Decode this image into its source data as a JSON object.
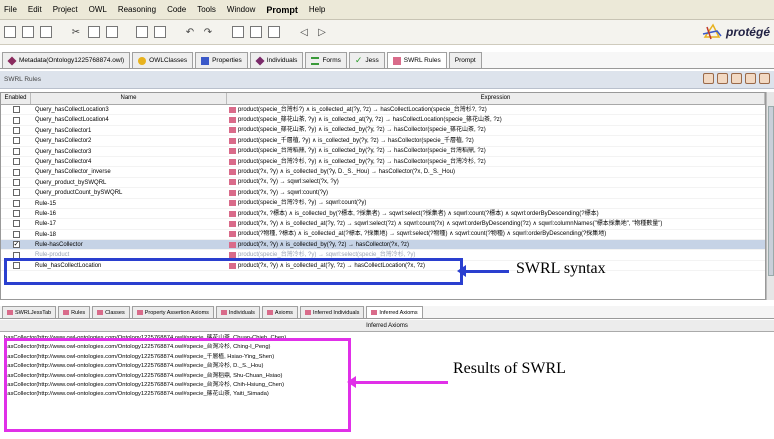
{
  "menu": [
    "File",
    "Edit",
    "Project",
    "OWL",
    "Reasoning",
    "Code",
    "Tools",
    "Window",
    "Prompt",
    "Help"
  ],
  "logo": {
    "text": "protégé"
  },
  "tabs": [
    {
      "label": "Metadata(Ontology1225768874.owl)",
      "icon": "diamond-icon",
      "color": "#8a2b5e"
    },
    {
      "label": "OWLClasses",
      "icon": "circle-icon",
      "color": "#e8b21e"
    },
    {
      "label": "Properties",
      "icon": "square-icon",
      "color": "#3b59c9"
    },
    {
      "label": "Individuals",
      "icon": "diamond-icon",
      "color": "#7a2a6a"
    },
    {
      "label": "Forms",
      "icon": "lines-icon",
      "color": "#3a9a3a"
    },
    {
      "label": "Jess",
      "icon": "check-icon",
      "color": "#2a9a2a"
    },
    {
      "label": "SWRL Rules",
      "icon": "rule-arrow-icon",
      "color": "#d96b8a"
    },
    {
      "label": "Prompt",
      "icon": "",
      "color": ""
    }
  ],
  "active_tab": 6,
  "panel_title": "SWRL Rules",
  "grid": {
    "headers": [
      "Enabled",
      "Name",
      "Expression"
    ],
    "rows": [
      {
        "name": "Query_hasCollectLocation3",
        "expr": "product(specie_台灣杉?) ∧ is_collected_at(?y, ?z) → hasCollectLocation(specie_台灣杉?, ?z)",
        "checked": false
      },
      {
        "name": "Query_hasCollectLocation4",
        "expr": "product(specie_篠花山茶, ?y) ∧ is_collected_at(?y, ?z) → hasCollectLocation(specie_篠花山茶, ?z)",
        "checked": false
      },
      {
        "name": "Query_hasCollector1",
        "expr": "product(specie_篠花山茶, ?y) ∧ is_collected_by(?y, ?z) → hasCollector(specie_篠花山茶, ?z)",
        "checked": false
      },
      {
        "name": "Query_hasCollector2",
        "expr": "product(specie_千層植, ?y) ∧ is_collected_by(?y, ?z) → hasCollector(specie_千層植, ?z)",
        "checked": false
      },
      {
        "name": "Query_hasCollector3",
        "expr": "product(specie_台灣稻鼎, ?y) ∧ is_collected_by(?y, ?z) → hasCollector(specie_台灣稻鼎, ?z)",
        "checked": false
      },
      {
        "name": "Query_hasCollector4",
        "expr": "product(specie_台灣冷杉, ?y) ∧ is_collected_by(?y, ?z) → hasCollector(specie_台灣冷杉, ?z)",
        "checked": false
      },
      {
        "name": "Query_hasCollector_inverse",
        "expr": "product(?x, ?y) ∧ is_collected_by(?y, D._S._Hou) → hasCollector(?x, D._S._Hou)",
        "checked": false
      },
      {
        "name": "Query_product_bySWQRL",
        "expr": "product(?x, ?y) → sqwrl:select(?x, ?y)",
        "checked": false
      },
      {
        "name": "Query_productCount_bySWQRL",
        "expr": "product(?x, ?y) → sqwrl:count(?y)",
        "checked": false
      },
      {
        "name": "Rule-15",
        "expr": "product(specie_台灣冷杉, ?y) → sqwrl:count(?y)",
        "checked": false
      },
      {
        "name": "Rule-16",
        "expr": "product(?x, ?標本) ∧ is_collected_by(?標本, ?採集者) → sqwrl:select(?採集者) ∧ sqwrl:count(?標本) ∧ sqwrl:orderByDescending(?標本)",
        "checked": false
      },
      {
        "name": "Rule-17",
        "expr": "product(?x, ?y) ∧ is_collected_at(?y, ?z) → sqwrl:select(?z) ∧ sqwrl:count(?x) ∧ sqwrl:orderByDescending(?z) ∧ sqwrl:columnNames(\"標本採集地\", \"物種數量\")",
        "checked": false
      },
      {
        "name": "Rule-18",
        "expr": "product(?物種, ?標本) ∧ is_collected_at(?標本, ?採集地) → sqwrl:select(?物種) ∧ sqwrl:count(?物種) ∧ sqwrl:orderByDescending(?採集地)",
        "checked": false
      },
      {
        "name": "Rule-hasCollector",
        "expr": "product(?x, ?y) ∧ is_collected_by(?y, ?z) → hasCollector(?x, ?z)",
        "checked": true
      },
      {
        "name": "Rule-product",
        "expr": "product(specie_台灣冷杉, ?y) → sqwrl:select(specie_台灣冷杉, ?y)",
        "checked": false
      },
      {
        "name": "Rule_hasCollectLocation",
        "expr": "product(?x, ?y) ∧ is_collected_at(?y, ?z) → hasCollectLocation(?x, ?z)",
        "checked": false
      }
    ],
    "selected_row": 13
  },
  "annotation_swrl": "SWRL syntax",
  "bottom_tabs": [
    "SWRLJessTab",
    "Rules",
    "Classes",
    "Property Assertion Axioms",
    "Individuals",
    "Axioms",
    "Inferred Individuals",
    "Inferred Axioms"
  ],
  "bottom_active_tab": 7,
  "inferred_header": "Inferred Axioms",
  "inferred_axioms": [
    "hasCollector(http://www.owl-ontologies.com/Ontology1225768874.owl#specie_篠花山茶, Chuan-Chieh_Chen)",
    "hasCollector(http://www.owl-ontologies.com/Ontology1225768874.owl#specie_台灣冷杉, Ching-I_Peng)",
    "hasCollector(http://www.owl-ontologies.com/Ontology1225768874.owl#specie_千層植, Hsiao-Ying_Shen)",
    "hasCollector(http://www.owl-ontologies.com/Ontology1225768874.owl#specie_台灣冷杉, D._S._Hou)",
    "hasCollector(http://www.owl-ontologies.com/Ontology1225768874.owl#specie_台灣稻鼎, Shu-Chuan_Hsiao)",
    "hasCollector(http://www.owl-ontologies.com/Ontology1225768874.owl#specie_台灣冷杉, Chih-Hsiung_Chen)",
    "hasCollector(http://www.owl-ontologies.com/Ontology1225768874.owl#specie_篠花山茶, Yaiti_Simada)"
  ],
  "annotation_results": "Results of SWRL",
  "colors": {
    "blue_box": "#2a3fcf",
    "magenta_box": "#e030e8",
    "selected_row": "#c6d3e6"
  }
}
